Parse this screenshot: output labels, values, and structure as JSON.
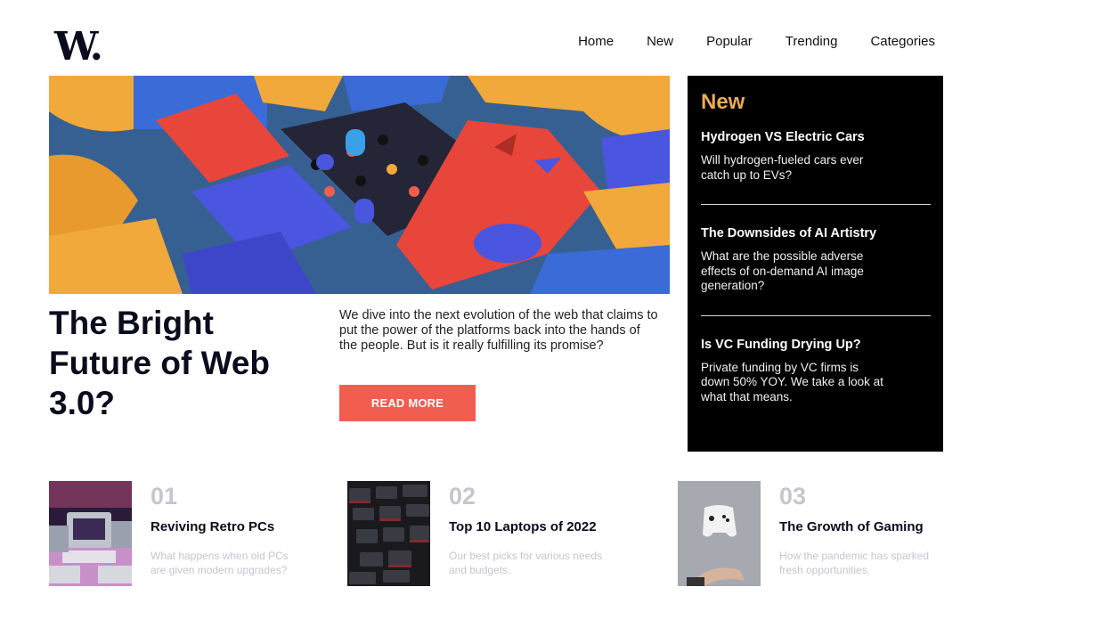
{
  "brand": {
    "logo_text": "W",
    "logo_dot": "."
  },
  "nav": [
    "Home",
    "New",
    "Popular",
    "Trending",
    "Categories"
  ],
  "hero": {
    "title": "The Bright Future of Web 3.0?",
    "text": "We dive into the next evolution of the web that claims to put the power of the platforms back into the hands of the people. But is it really fulfilling its promise?",
    "button_label": "READ MORE"
  },
  "new_panel": {
    "heading": "New",
    "items": [
      {
        "title": "Hydrogen VS Electric Cars",
        "text": "Will hydrogen-fueled cars ever catch up to EVs?"
      },
      {
        "title": "The Downsides of AI Artistry",
        "text": "What are the possible adverse effects of on-demand AI image generation?"
      },
      {
        "title": "Is VC Funding Drying Up?",
        "text": "Private funding by VC firms is down 50% YOY. We take a look at what that means."
      }
    ]
  },
  "cards": [
    {
      "number": "01",
      "title": "Reviving Retro PCs",
      "text": "What happens when old PCs are given modern upgrades?"
    },
    {
      "number": "02",
      "title": "Top 10 Laptops of 2022",
      "text": "Our best picks for various needs and budgets."
    },
    {
      "number": "03",
      "title": "The Growth of Gaming",
      "text": "How the pandemic has sparked fresh opportunities."
    }
  ],
  "colors": {
    "accent": "#f15e50",
    "panel_heading": "#e9ab53",
    "dark": "#0b0b1d",
    "muted": "#c5c6ce"
  }
}
